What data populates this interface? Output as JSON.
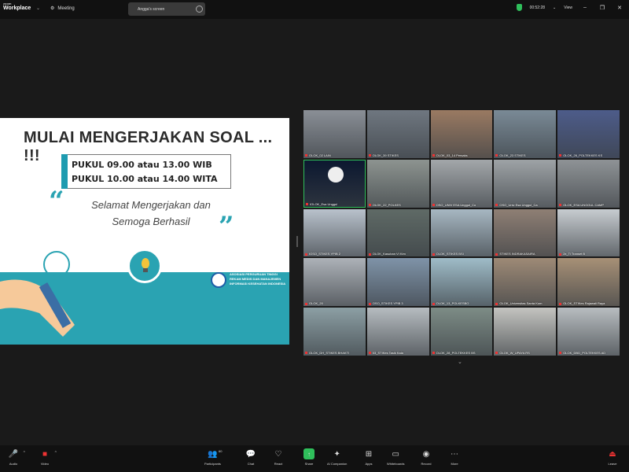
{
  "topbar": {
    "logo_top": "zoom",
    "logo_main": "Workplace",
    "meeting_label": "Meeting",
    "screen_share_label": "Angga's screen",
    "timer": "00:52:28",
    "view_label": "View"
  },
  "slide": {
    "title": "MULAI MENGERJAKAN SOAL ... !!!",
    "time_line_1": "PUKUL 09.00 atau 13.00 WIB",
    "time_line_2": "PUKUL 10.00 atau 14.00 WITA",
    "greeting_1": "Selamat Mengerjakan dan",
    "greeting_2": "Semoga Berhasil",
    "org_name": "ASOSIASI PERGURUAN TINGGI REKAM MEDIS DAN MANAJEMEN INFORMASI KESEHATAN INDONESIA"
  },
  "gallery": {
    "tiles": [
      {
        "label": "OLOK_02 LAIN",
        "color": "#8a8f96"
      },
      {
        "label": "OLOK_39 STIKES",
        "color": "#6f7780"
      },
      {
        "label": "OLOK_03_14 Persaks",
        "color": "#9a7a62"
      },
      {
        "label": "OLOK_23 STIKES",
        "color": "#7a8a96"
      },
      {
        "label": "OLOK_26_POLTEKKES KS",
        "color": "#4d5c8a"
      },
      {
        "label": "IOLOK_Esa Unggul",
        "color": "#0c1830"
      },
      {
        "label": "OLOK_22_POLKES",
        "color": "#8d9490"
      },
      {
        "label": "OSO_UNIV ESA Unggul_Co",
        "color": "#a3a7aa"
      },
      {
        "label": "OSO_Univ Esa Unggul_Ca",
        "color": "#9ea3a6"
      },
      {
        "label": "OLOK_ESA UNGGUL CAMP",
        "color": "#8f9396"
      },
      {
        "label": "IOSO_STIKES YPIB 2",
        "color": "#b9c2cc"
      },
      {
        "label": "OLOK_Kasuban VI Kim",
        "color": "#5f6a66"
      },
      {
        "label": "OLOK_STIKES BSI",
        "color": "#a7b7c2"
      },
      {
        "label": "STIKES INDRAKASAIRA",
        "color": "#8f7f74"
      },
      {
        "label": "2x_Ti Transet B",
        "color": "#c7ccd0"
      },
      {
        "label": "OLOK_20",
        "color": "#adb2b8"
      },
      {
        "label": "OSO_STIKES YPIB 3",
        "color": "#7f93a8"
      },
      {
        "label": "OLOK_13_POLKESBO",
        "color": "#9fbcc8"
      },
      {
        "label": "OLOK_Universitas Santa Kom",
        "color": "#9e8a76"
      },
      {
        "label": "OLOK_STIKes Rajawali Raya",
        "color": "#a79076"
      },
      {
        "label": "OLOK_DH_STIKES BHAKTI",
        "color": "#8c9fa4"
      },
      {
        "label": "03_STIKes Tasik Kala",
        "color": "#b6bcc0"
      },
      {
        "label": "OLOK_28_POLTEKKES BS",
        "color": "#7d8c86"
      },
      {
        "label": "OLOK_W_UPAYA RS",
        "color": "#c4c4c0"
      },
      {
        "label": "OLOK_DBD_POLTEKKES AD",
        "color": "#b8bdc0"
      }
    ]
  },
  "toolbar": {
    "audio": "Audio",
    "video": "Video",
    "participants": "Participants",
    "participants_count": "60",
    "chat": "Chat",
    "react": "React",
    "share": "Share",
    "ai": "AI Companion",
    "apps": "Apps",
    "whiteboards": "Whiteboards",
    "record": "Record",
    "more": "More",
    "leave": "Leave"
  },
  "colors": {
    "teal": "#2aa3b2",
    "share_green": "#2fbf5b",
    "leave_red": "#e33333"
  }
}
